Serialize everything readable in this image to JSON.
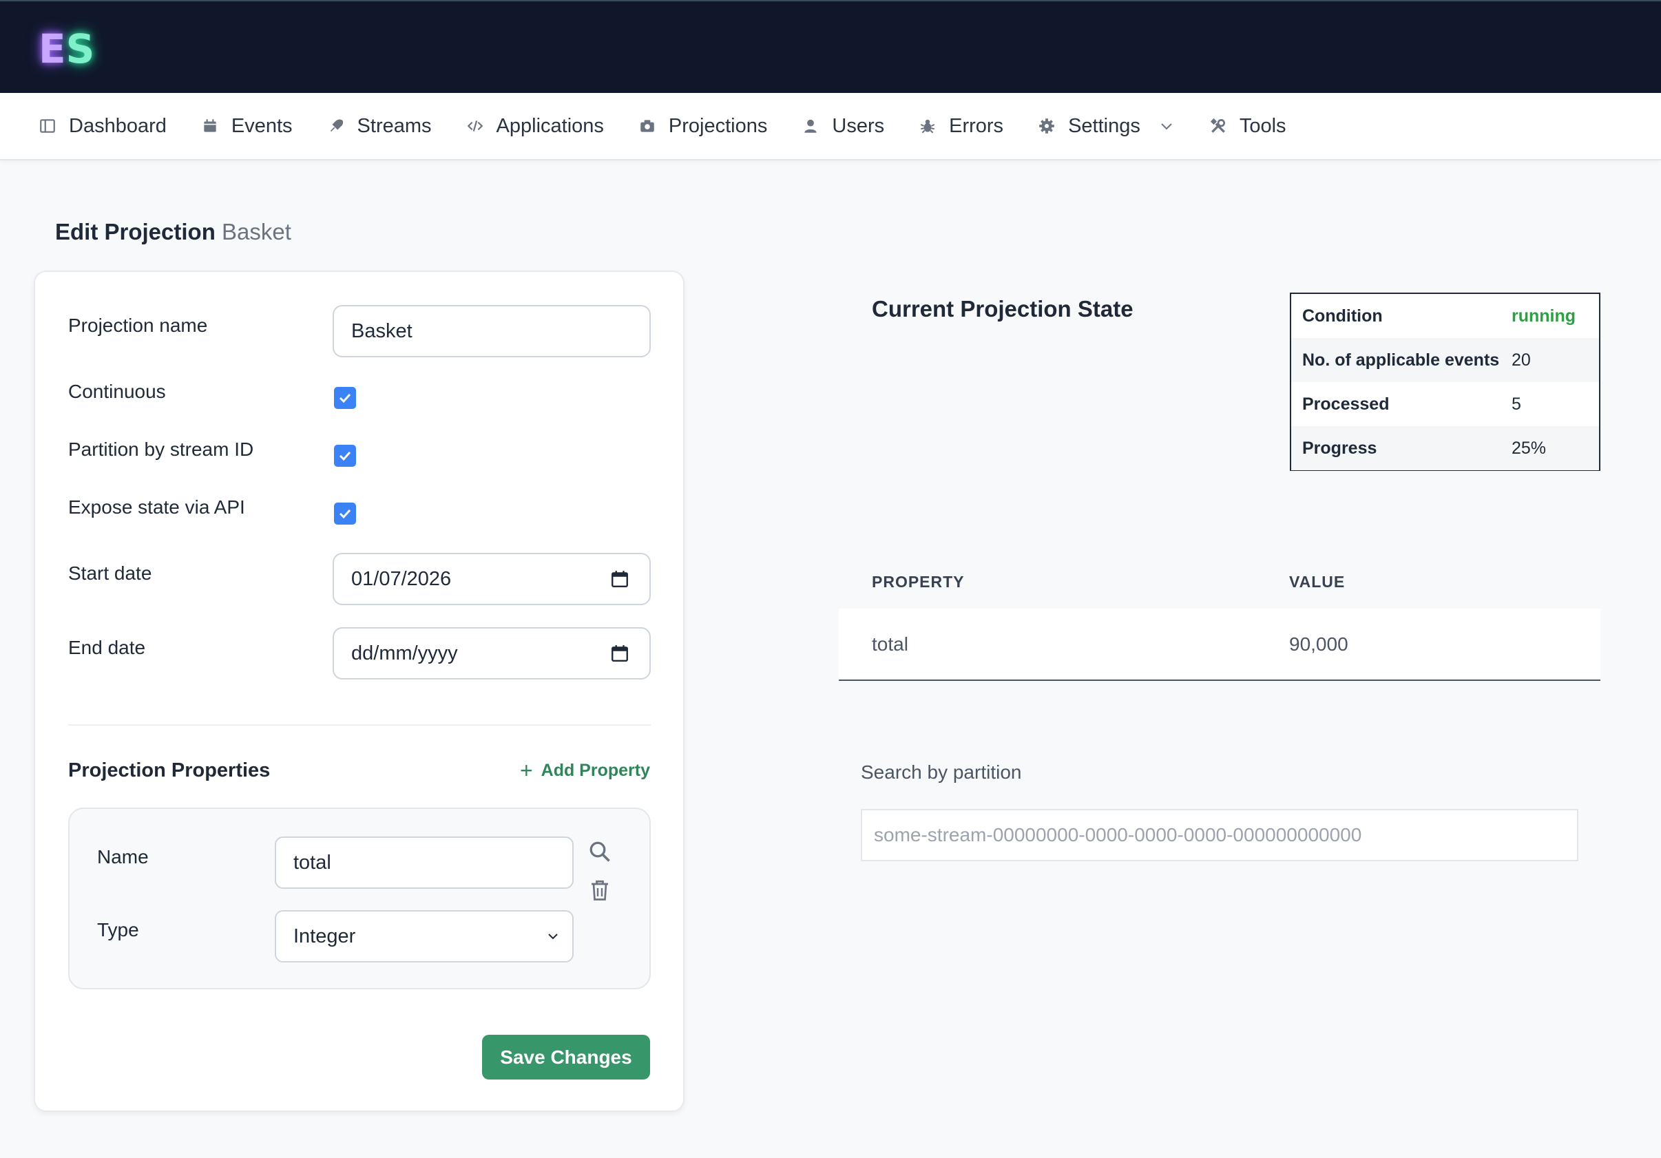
{
  "logo": {
    "letter1": "E",
    "letter2": "S"
  },
  "nav": {
    "items": [
      {
        "label": "Dashboard",
        "icon": "dashboard-icon"
      },
      {
        "label": "Events",
        "icon": "calendar-icon"
      },
      {
        "label": "Streams",
        "icon": "stream-icon"
      },
      {
        "label": "Applications",
        "icon": "code-icon"
      },
      {
        "label": "Projections",
        "icon": "camera-icon"
      },
      {
        "label": "Users",
        "icon": "user-icon"
      },
      {
        "label": "Errors",
        "icon": "bug-icon"
      },
      {
        "label": "Settings",
        "icon": "gear-icon"
      },
      {
        "label": "Tools",
        "icon": "tools-icon"
      }
    ]
  },
  "heading": {
    "title": "Edit Projection",
    "subtitle": "Basket"
  },
  "form": {
    "name_label": "Projection name",
    "name_value": "Basket",
    "continuous_label": "Continuous",
    "continuous_checked": true,
    "partition_label": "Partition by stream ID",
    "partition_checked": true,
    "expose_label": "Expose state via API",
    "expose_checked": true,
    "start_label": "Start date",
    "start_value": "01/07/2026",
    "end_label": "End date",
    "end_placeholder": "dd/mm/yyyy",
    "properties_title": "Projection Properties",
    "add_property": "Add Property",
    "property": {
      "name_label": "Name",
      "name_value": "total",
      "type_label": "Type",
      "type_value": "Integer"
    },
    "save_label": "Save Changes"
  },
  "state": {
    "title": "Current Projection State",
    "rows": [
      {
        "key": "Condition",
        "value": "running"
      },
      {
        "key": "No. of applicable events",
        "value": "20"
      },
      {
        "key": "Processed",
        "value": "5"
      },
      {
        "key": "Progress",
        "value": "25%"
      }
    ],
    "status_color": "#2ea043"
  },
  "properties_table": {
    "headers": [
      "PROPERTY",
      "VALUE"
    ],
    "rows": [
      {
        "property": "total",
        "value": "90,000"
      }
    ]
  },
  "search": {
    "label": "Search by partition",
    "placeholder": "some-stream-00000000-0000-0000-0000-000000000000"
  },
  "colors": {
    "topbar": "#10172a",
    "accent_green": "#38976a",
    "checkbox_blue": "#3b82f6"
  }
}
